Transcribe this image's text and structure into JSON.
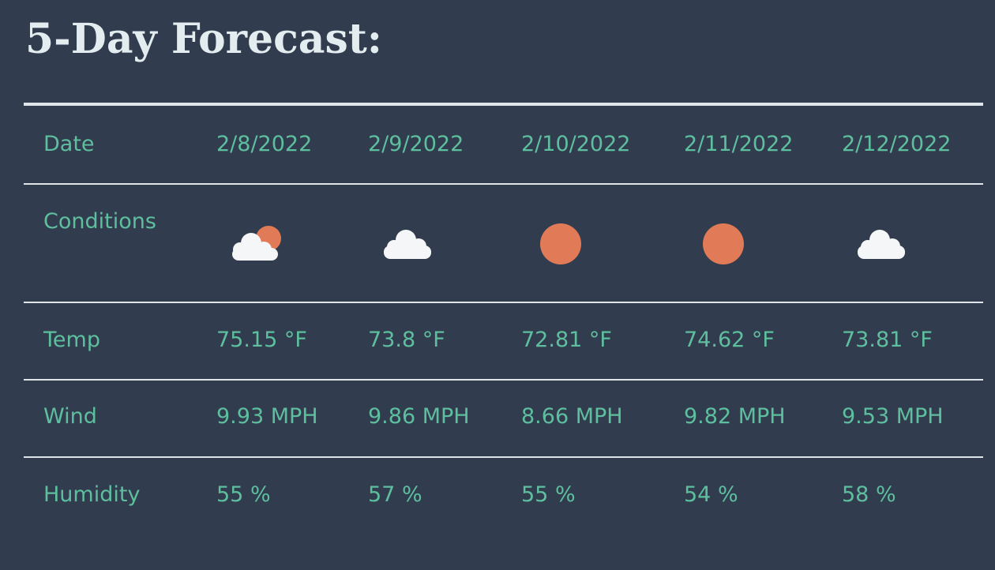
{
  "title": "5-Day Forecast:",
  "row_labels": {
    "date": "Date",
    "conditions": "Conditions",
    "temp": "Temp",
    "wind": "Wind",
    "humidity": "Humidity"
  },
  "days": [
    {
      "date": "2/8/2022",
      "icon": "partly-cloudy-icon",
      "temp": "75.15 °F",
      "wind": "9.93 MPH",
      "humidity": "55 %"
    },
    {
      "date": "2/9/2022",
      "icon": "cloud-icon",
      "temp": "73.8 °F",
      "wind": "9.86 MPH",
      "humidity": "57 %"
    },
    {
      "date": "2/10/2022",
      "icon": "sun-icon",
      "temp": "72.81 °F",
      "wind": "8.66 MPH",
      "humidity": "55 %"
    },
    {
      "date": "2/11/2022",
      "icon": "sun-icon",
      "temp": "74.62 °F",
      "wind": "9.82 MPH",
      "humidity": "54 %"
    },
    {
      "date": "2/12/2022",
      "icon": "cloud-icon",
      "temp": "73.81 °F",
      "wind": "9.53 MPH",
      "humidity": "58 %"
    }
  ],
  "colors": {
    "background": "#313d4e",
    "title": "#e3edf0",
    "text": "#5ebf9f",
    "sun": "#e07a57",
    "cloud": "#f4f6f7",
    "rule": "#dfe6ea"
  }
}
